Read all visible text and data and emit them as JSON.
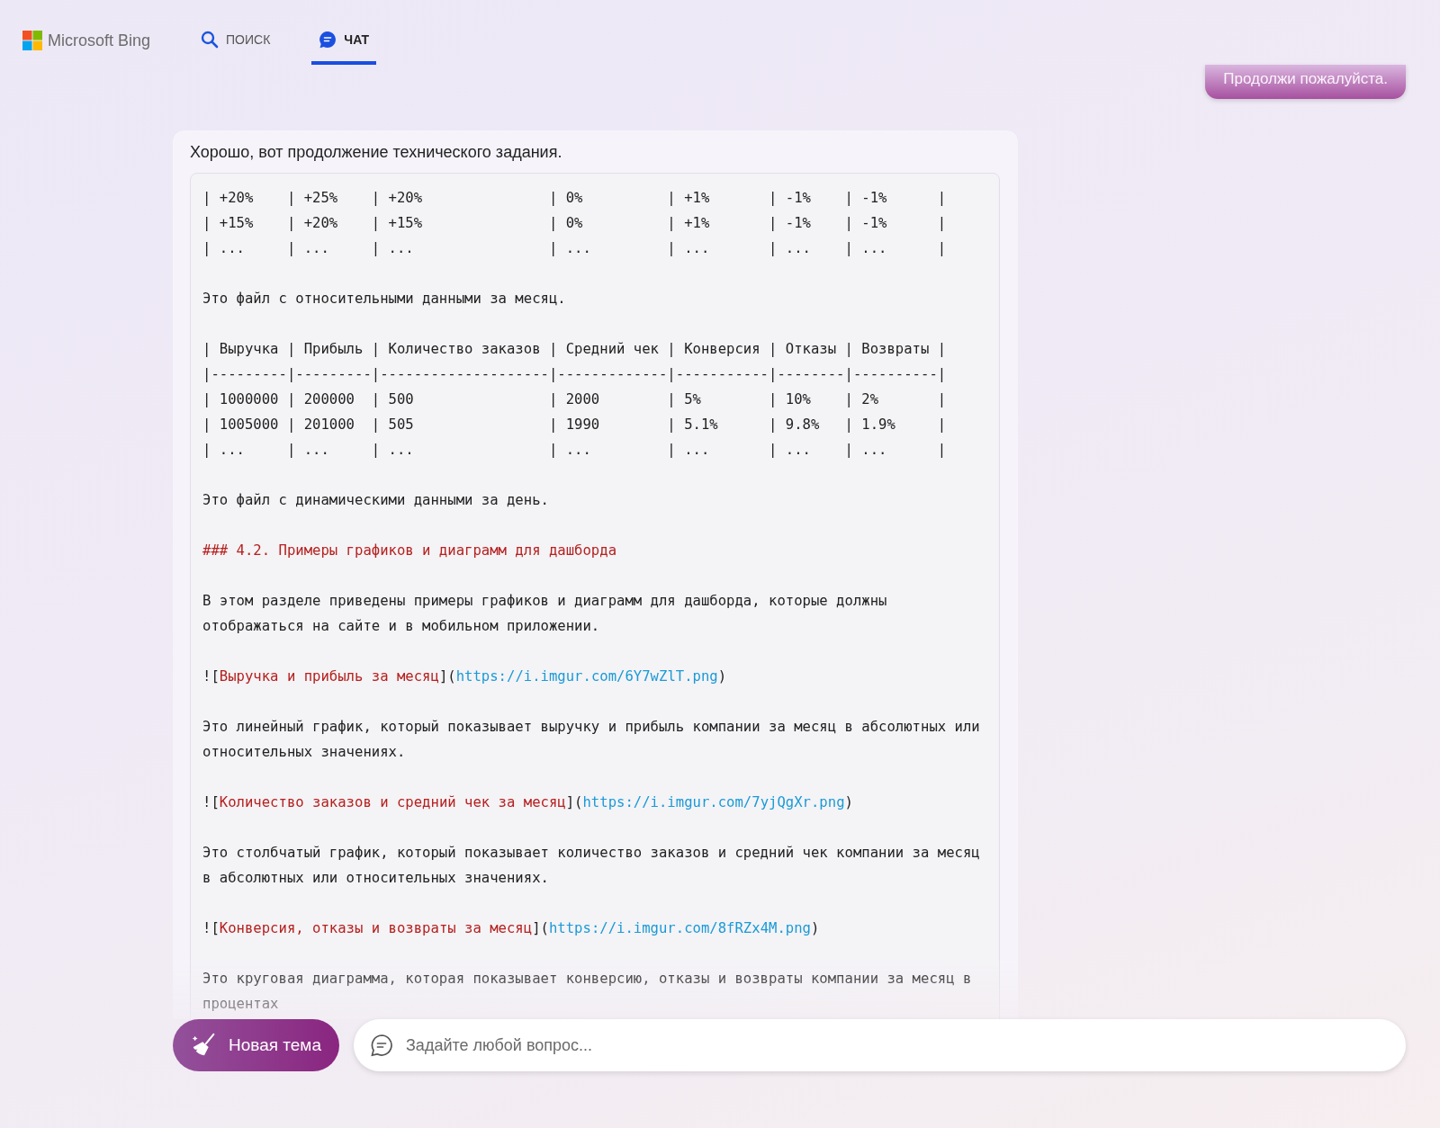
{
  "header": {
    "brand": "Microsoft Bing",
    "tabs": [
      {
        "kind": "search",
        "label": "ПОИСК",
        "selected": false
      },
      {
        "kind": "chat",
        "label": "ЧАТ",
        "selected": true
      }
    ]
  },
  "user_message": "Продолжи пожалуйста.",
  "answer": {
    "intro": "Хорошо, вот продолжение технического задания.",
    "code_lines": [
      {
        "kind": "text",
        "text": "| +20%    | +25%    | +20%               | 0%          | +1%       | -1%    | -1%      |"
      },
      {
        "kind": "text",
        "text": "| +15%    | +20%    | +15%               | 0%          | +1%       | -1%    | -1%      |"
      },
      {
        "kind": "text",
        "text": "| ...     | ...     | ...                | ...         | ...       | ...    | ...      |"
      },
      {
        "kind": "blank"
      },
      {
        "kind": "text",
        "text": "Это файл с относительными данными за месяц."
      },
      {
        "kind": "blank"
      },
      {
        "kind": "text",
        "text": "| Выручка | Прибыль | Количество заказов | Средний чек | Конверсия | Отказы | Возвраты |"
      },
      {
        "kind": "text",
        "text": "|---------|---------|--------------------|-------------|-----------|--------|----------|"
      },
      {
        "kind": "text",
        "text": "| 1000000 | 200000  | 500                | 2000        | 5%        | 10%    | 2%       |"
      },
      {
        "kind": "text",
        "text": "| 1005000 | 201000  | 505                | 1990        | 5.1%      | 9.8%   | 1.9%     |"
      },
      {
        "kind": "text",
        "text": "| ...     | ...     | ...                | ...         | ...       | ...    | ...      |"
      },
      {
        "kind": "blank"
      },
      {
        "kind": "text",
        "text": "Это файл с динамическими данными за день."
      },
      {
        "kind": "blank"
      },
      {
        "kind": "heading",
        "text": "### 4.2. Примеры графиков и диаграмм для дашборда"
      },
      {
        "kind": "blank"
      },
      {
        "kind": "text",
        "text": "В этом разделе приведены примеры графиков и диаграмм для дашборда, которые должны отображаться на сайте и в мобильном приложении."
      },
      {
        "kind": "blank"
      },
      {
        "kind": "image",
        "open": "![",
        "alt": "Выручка и прибыль за месяц",
        "mid": "](",
        "url": "https://i.imgur.com/6Y7wZlT.png",
        "close": ")"
      },
      {
        "kind": "blank"
      },
      {
        "kind": "text",
        "text": "Это линейный график, который показывает выручку и прибыль компании за месяц в абсолютных или относительных значениях."
      },
      {
        "kind": "blank"
      },
      {
        "kind": "image",
        "open": "![",
        "alt": "Количество заказов и средний чек за месяц",
        "mid": "](",
        "url": "https://i.imgur.com/7yjQgXr.png",
        "close": ")"
      },
      {
        "kind": "blank"
      },
      {
        "kind": "text",
        "text": "Это столбчатый график, который показывает количество заказов и средний чек компании за месяц в абсолютных или относительных значениях."
      },
      {
        "kind": "blank"
      },
      {
        "kind": "image",
        "open": "![",
        "alt": "Конверсия, отказы и возвраты за месяц",
        "mid": "](",
        "url": "https://i.imgur.com/8fRZx4M.png",
        "close": ")"
      },
      {
        "kind": "blank"
      },
      {
        "kind": "text",
        "text": "Это круговая диаграмма, которая показывает конверсию, отказы и возвраты компании за месяц в процентах"
      }
    ]
  },
  "new_topic_button": "Новая тема",
  "composer": {
    "placeholder": "Задайте любой вопрос..."
  }
}
